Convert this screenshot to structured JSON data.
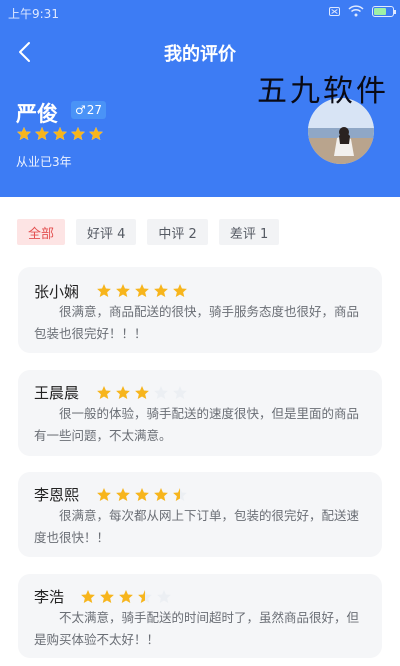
{
  "status_bar": {
    "time": "上午9:31"
  },
  "header": {
    "title": "我的评价"
  },
  "watermark": "五九软件",
  "profile": {
    "name": "严俊",
    "gender_symbol": "♂",
    "age": "27",
    "rating": 5,
    "years_text": "从业已3年"
  },
  "filters": [
    {
      "label": "全部"
    },
    {
      "label": "好评 4"
    },
    {
      "label": "中评 2"
    },
    {
      "label": "差评 1"
    }
  ],
  "reviews": [
    {
      "name": "张小娴",
      "rating": 5,
      "text": "很满意，商品配送的很快，骑手服务态度也很好，商品包装也很完好！！！"
    },
    {
      "name": "王晨晨",
      "rating": 3,
      "text": "很一般的体验，骑手配送的速度很快，但是里面的商品有一些问题，不太满意。"
    },
    {
      "name": "李恩熙",
      "rating": 4.5,
      "text": "很满意，每次都从网上下订单，包装的很完好，配送速度也很快！！"
    },
    {
      "name": "李浩",
      "rating": 3.5,
      "text": "不太满意，骑手配送的时间超时了，虽然商品很好，但是购买体验不太好！！"
    }
  ],
  "colors": {
    "header_bg": "#3d7cf4",
    "star_filled": "#f7b51c",
    "star_empty": "#eceff3",
    "profile_star_empty": "#ffffff",
    "tab_active_bg": "#fde4e4",
    "tab_active_text": "#e35050"
  }
}
